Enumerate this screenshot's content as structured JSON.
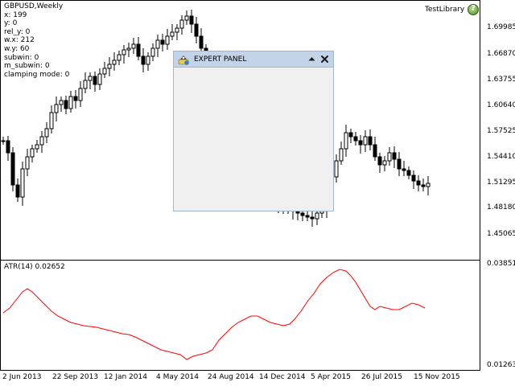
{
  "chart": {
    "symbol_period": "GBPUSD,Weekly",
    "info_lines": [
      "x: 199",
      "y: 0",
      "rel_y: 0",
      "w.x: 212",
      "w.y: 60",
      "subwin: 0",
      "m_subwin: 0",
      "clamping mode: 0"
    ],
    "library_label": "TestLibrary",
    "price_axis": [
      "1.69985",
      "1.66870",
      "1.63755",
      "1.60640",
      "1.57525",
      "1.54410",
      "1.51295",
      "1.48180",
      "1.45065"
    ],
    "atr_label": "ATR(14) 0.02652",
    "atr_axis": [
      "0.03851",
      "0.01263"
    ],
    "date_axis": [
      "2 Jun 2013",
      "22 Sep 2013",
      "12 Jan 2014",
      "4 May 2014",
      "24 Aug 2014",
      "14 Dec 2014",
      "5 Apr 2015",
      "26 Jul 2015",
      "15 Nov 2015"
    ],
    "colors": {
      "candle": "#000000",
      "atr_line": "#ff0000",
      "panel_caption": "#c4d4e8",
      "panel_body": "#f0f0f0"
    }
  },
  "panel": {
    "title": "EXPERT PANEL",
    "minimize_icon": "triangle-up-icon",
    "close_icon": "close-icon"
  }
}
